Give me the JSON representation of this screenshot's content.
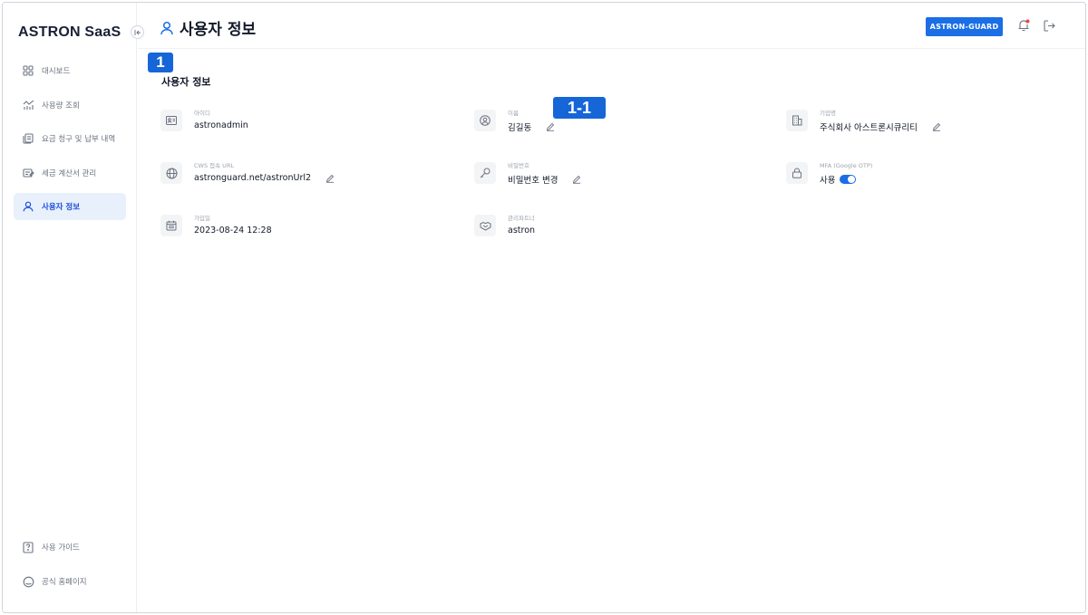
{
  "brand": "ASTRON SaaS",
  "header": {
    "title": "사용자 정보",
    "org_button": "ASTRON-GUARD"
  },
  "sidebar": {
    "items": [
      {
        "label": "대시보드",
        "icon": "grid-icon"
      },
      {
        "label": "사용량 조회",
        "icon": "chart-icon"
      },
      {
        "label": "요금 청구 및 납부 내역",
        "icon": "receipt-icon"
      },
      {
        "label": "세금 계산서 관리",
        "icon": "invoice-icon"
      },
      {
        "label": "사용자 정보",
        "icon": "user-icon",
        "active": true
      }
    ],
    "bottom_items": [
      {
        "label": "사용 가이드",
        "icon": "guide-icon"
      },
      {
        "label": "공식 홈페이지",
        "icon": "home-icon"
      }
    ]
  },
  "badges": {
    "main": "1",
    "sub": "1-1"
  },
  "section": {
    "title": "사용자 정보"
  },
  "fields": {
    "id": {
      "label": "아이디",
      "value": "astronadmin"
    },
    "name": {
      "label": "이름",
      "value": "김길동"
    },
    "company": {
      "label": "기업명",
      "value": "주식회사 아스트론시큐리티"
    },
    "cws_url": {
      "label": "CWS 접속 URL",
      "value": "astronguard.net/astronUrl2"
    },
    "password": {
      "label": "비밀번호",
      "value": "비밀번호 변경"
    },
    "mfa": {
      "label": "MFA (Google OTP)",
      "value": "사용",
      "enabled": true
    },
    "joined": {
      "label": "가입일",
      "value": "2023-08-24 12:28"
    },
    "partner": {
      "label": "관리파트너",
      "value": "astron"
    }
  },
  "colors": {
    "accent": "#1a6ee6",
    "badge": "#1666d8",
    "active_bg": "#e8f0fc",
    "notify_dot": "#ef4444"
  }
}
